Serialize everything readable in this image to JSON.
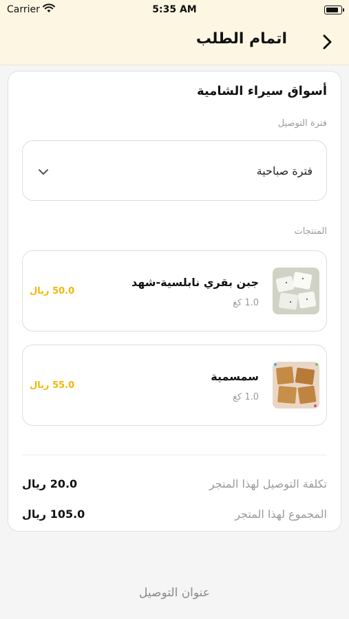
{
  "status_bar": {
    "carrier": "Carrier",
    "time": "5:35 AM",
    "icons": [
      "wifi-icon",
      "battery-icon"
    ]
  },
  "nav": {
    "title": "اتمام الطلب",
    "back_icon": "chevron-right-icon"
  },
  "store": {
    "name": "أسواق سيراء الشامية"
  },
  "delivery_period": {
    "label": "فترة التوصيل",
    "selected": "فترة صباحية",
    "icon": "chevron-down-icon"
  },
  "products": {
    "label": "المنتجات",
    "items": [
      {
        "name": "جبن بقري نابلسية-شهد",
        "qty": "1.0 كغ",
        "price": "50.0 ريال"
      },
      {
        "name": "سمسمية",
        "qty": "1.0 كغ",
        "price": "55.0 ريال"
      }
    ]
  },
  "summary": {
    "delivery_cost_label": "تكلفة التوصيل لهذا المتجر",
    "delivery_cost_value": "20.0 ريال",
    "total_label": "المجموع لهذا المتجر",
    "total_value": "105.0 ريال"
  },
  "footer": {
    "delivery_address": "عنوان التوصيل"
  },
  "colors": {
    "header_bg": "#fdf6e3",
    "price_accent": "#f2b705"
  }
}
